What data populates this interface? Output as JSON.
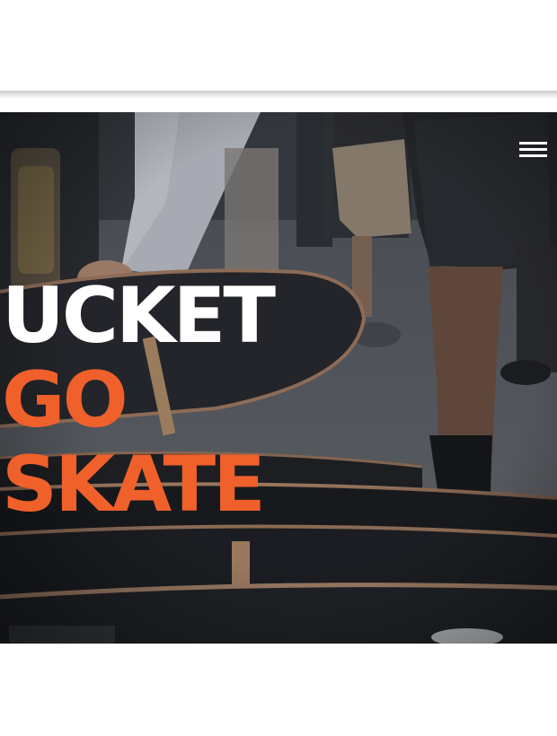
{
  "hero": {
    "headline_line1": "UCKET",
    "headline_line2": "GO",
    "headline_line3": "SKATE"
  },
  "header": {
    "menu_icon": "hamburger-menu-icon"
  },
  "colors": {
    "accent": "#f0602b",
    "headline_white": "#ffffff",
    "overlay": "#2e3038"
  }
}
